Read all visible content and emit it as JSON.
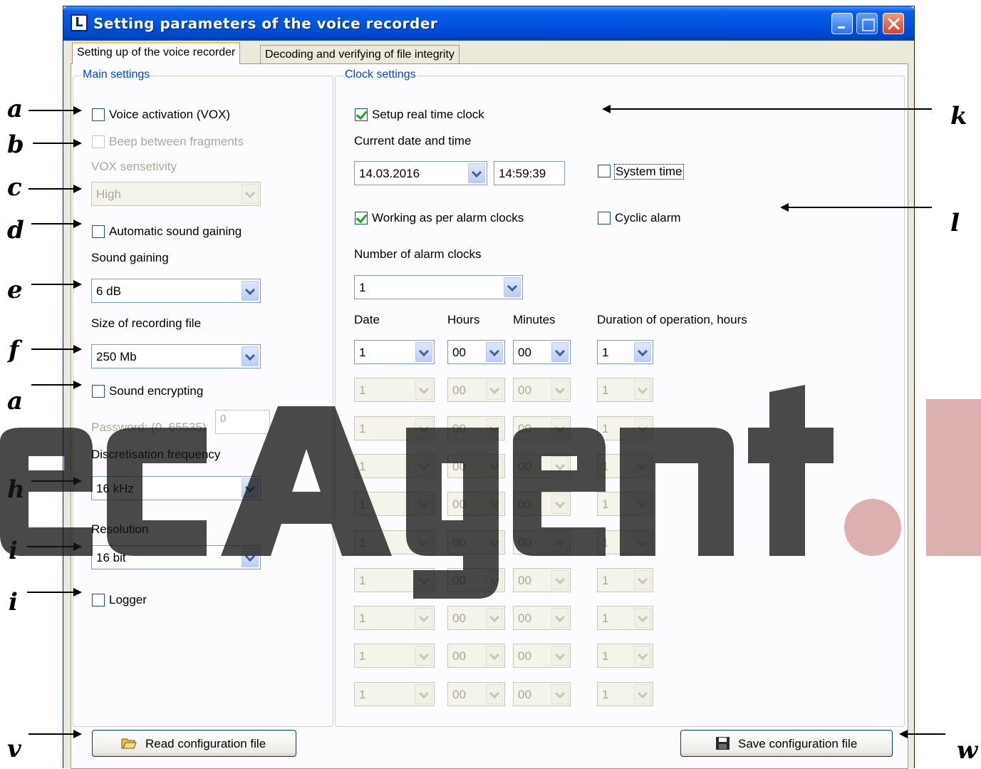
{
  "window": {
    "title": "Setting parameters of the voice recorder",
    "icon": "app-icon",
    "controls": [
      "minimize-icon",
      "maximize-icon",
      "close-icon"
    ]
  },
  "tabs": [
    {
      "label": "Setting up of the voice recorder",
      "active": true
    },
    {
      "label": "Decoding and verifying of file integrity",
      "active": false
    }
  ],
  "main_settings": {
    "group_label": "Main settings",
    "vox": {
      "label": "Voice activation (VOX)",
      "checked": false
    },
    "beep": {
      "label": "Beep between fragments",
      "checked": false,
      "enabled": false
    },
    "vox_sensitivity": {
      "label": "VOX sensetivity",
      "value": "High",
      "enabled": false
    },
    "auto_gain": {
      "label": "Automatic sound gaining",
      "checked": false
    },
    "sound_gaining": {
      "label": "Sound gaining",
      "value": "6 dB"
    },
    "file_size": {
      "label": "Size of recording file",
      "value": "250 Mb"
    },
    "encrypting": {
      "label": "Sound encrypting",
      "checked": false
    },
    "password": {
      "label": "Password: (0..65535)",
      "value": "0",
      "enabled": false
    },
    "frequency": {
      "label": "Discretisation frequency",
      "value": "16 kHz"
    },
    "resolution": {
      "label": "Resolution",
      "value": "16 bit"
    },
    "logger": {
      "label": "Logger",
      "checked": false
    }
  },
  "clock_settings": {
    "group_label": "Clock settings",
    "setup_rtc": {
      "label": "Setup real time clock",
      "checked": true
    },
    "current_label": "Current date and time",
    "date_value": "14.03.2016",
    "time_value": "14:59:39",
    "system_time": {
      "label": "System time",
      "checked": false
    },
    "alarm_mode": {
      "label": "Working as per alarm clocks",
      "checked": true
    },
    "cyclic": {
      "label": "Cyclic alarm",
      "checked": false
    },
    "num_alarms_label": "Number of alarm clocks",
    "num_alarms_value": "1",
    "headers": {
      "date": "Date",
      "hours": "Hours",
      "minutes": "Minutes",
      "duration": "Duration of operation, hours"
    },
    "rows": [
      {
        "date": "1",
        "hours": "00",
        "minutes": "00",
        "duration": "1",
        "enabled": true
      },
      {
        "date": "1",
        "hours": "00",
        "minutes": "00",
        "duration": "1",
        "enabled": false
      },
      {
        "date": "1",
        "hours": "00",
        "minutes": "00",
        "duration": "1",
        "enabled": false
      },
      {
        "date": "1",
        "hours": "00",
        "minutes": "00",
        "duration": "1",
        "enabled": false
      },
      {
        "date": "1",
        "hours": "00",
        "minutes": "00",
        "duration": "1",
        "enabled": false
      },
      {
        "date": "1",
        "hours": "00",
        "minutes": "00",
        "duration": "1",
        "enabled": false
      },
      {
        "date": "1",
        "hours": "00",
        "minutes": "00",
        "duration": "1",
        "enabled": false
      },
      {
        "date": "1",
        "hours": "00",
        "minutes": "00",
        "duration": "1",
        "enabled": false
      },
      {
        "date": "1",
        "hours": "00",
        "minutes": "00",
        "duration": "1",
        "enabled": false
      },
      {
        "date": "1",
        "hours": "00",
        "minutes": "00",
        "duration": "1",
        "enabled": false
      }
    ]
  },
  "buttons": {
    "read": {
      "label": "Read configuration file",
      "icon": "open-folder-icon"
    },
    "save": {
      "label": "Save configuration file",
      "icon": "floppy-disk-icon"
    }
  },
  "annotations": {
    "a": "a",
    "b": "b",
    "c": "c",
    "d": "d",
    "e": "e",
    "f": "f",
    "g": "a",
    "h": "h",
    "i": "i",
    "j": "i",
    "k": "k",
    "l": "l",
    "v": "v",
    "w": "w"
  },
  "watermark": {
    "text": "ecAgent.I",
    "colors": [
      "#1a1a1a",
      "#d9a0a0"
    ]
  },
  "colors": {
    "titlebar": "#0054e3",
    "group_label": "#0046d5",
    "check_mark": "#21a121"
  }
}
